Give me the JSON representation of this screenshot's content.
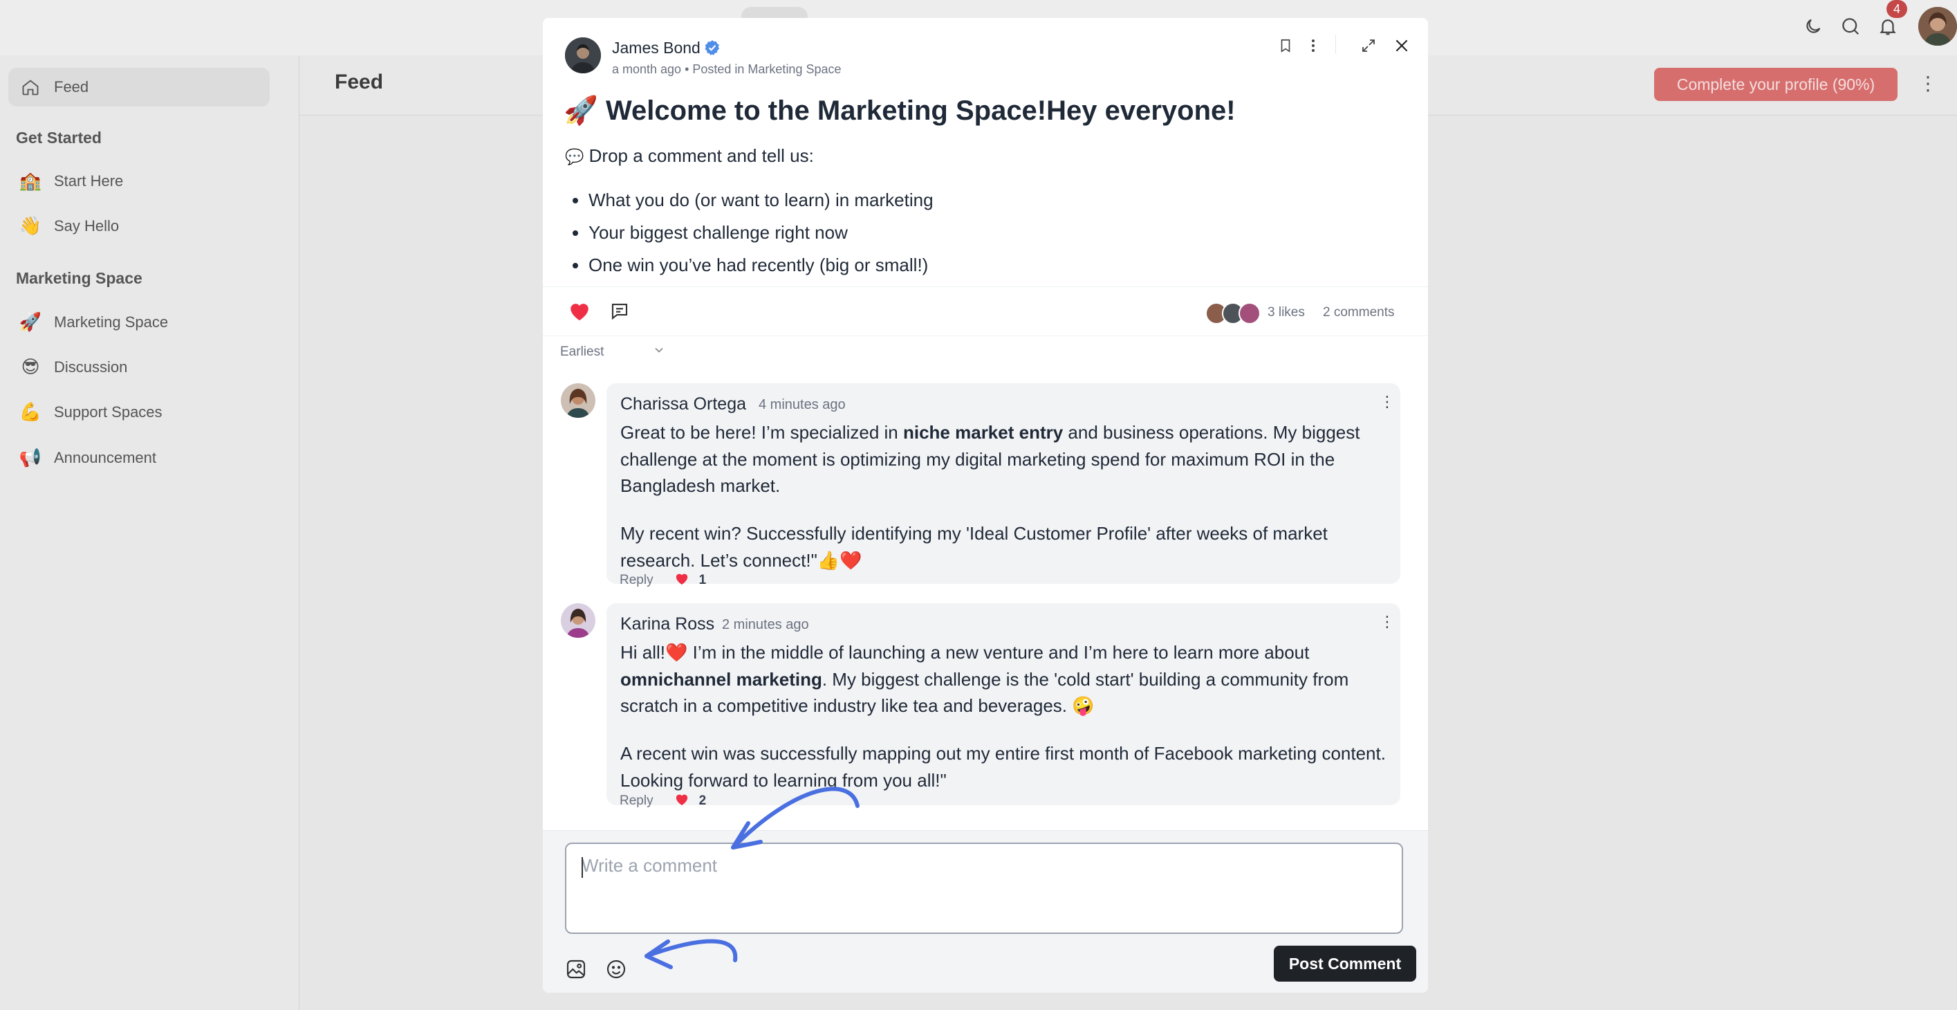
{
  "app": {
    "notification_count": "4",
    "brand_color": "#d76e6e",
    "accent_blue": "#4a6fe0"
  },
  "sidebar": {
    "feed_item": {
      "label": "Feed",
      "icon": "home-icon"
    },
    "sections": [
      {
        "title": "Get Started",
        "items": [
          {
            "label": "Start Here",
            "icon": "🏫"
          },
          {
            "label": "Say Hello",
            "icon": "👋"
          }
        ]
      },
      {
        "title": "Marketing Space",
        "items": [
          {
            "label": "Marketing Space",
            "icon": "🚀"
          },
          {
            "label": "Discussion",
            "icon": "😎"
          },
          {
            "label": "Support Spaces",
            "icon": "💪"
          },
          {
            "label": "Announcement",
            "icon": "📢"
          }
        ]
      }
    ]
  },
  "header": {
    "title": "Feed",
    "profile_button": "Complete your profile (90%)"
  },
  "post": {
    "author": "James Bond",
    "meta": "a month ago • Posted in Marketing Space",
    "title_emoji": "🚀",
    "title": "Welcome to the Marketing Space!Hey everyone!",
    "intro_emoji": "💬",
    "intro": "Drop a comment and tell us:",
    "bullets": [
      "What you do (or want to learn) in marketing",
      "Your biggest challenge right now",
      "One win you’ve had recently (big or small!)"
    ],
    "likes": "3 likes",
    "comments": "2 comments"
  },
  "comments_section": {
    "sort": "Earliest",
    "comments": [
      {
        "author": "Charissa Ortega",
        "time": "4 minutes ago",
        "p1_before": "Great to be here! I’m specialized in ",
        "p1_bold": "niche market entry",
        "p1_after": " and business operations. My biggest challenge at the moment is optimizing my digital marketing spend for maximum ROI in the Bangladesh market.",
        "p2": "My recent win? Successfully identifying my 'Ideal Customer Profile' after weeks of market research. Let’s connect!\"👍❤️",
        "reply": "Reply",
        "likes": "1"
      },
      {
        "author": "Karina Ross",
        "time": "2 minutes ago",
        "p1_before": "Hi all!❤️ I’m in the middle of launching a new venture and I’m here to learn more about ",
        "p1_bold": "omnichannel marketing",
        "p1_after": ". My biggest challenge is the 'cold start' building a community from scratch in a competitive industry like tea and beverages. 🤪",
        "p2": "A recent win was successfully mapping out my entire first month of Facebook marketing content. Looking forward to learning from you all!\"",
        "reply": "Reply",
        "likes": "2"
      }
    ]
  },
  "composer": {
    "placeholder": "Write a comment",
    "submit": "Post Comment"
  }
}
